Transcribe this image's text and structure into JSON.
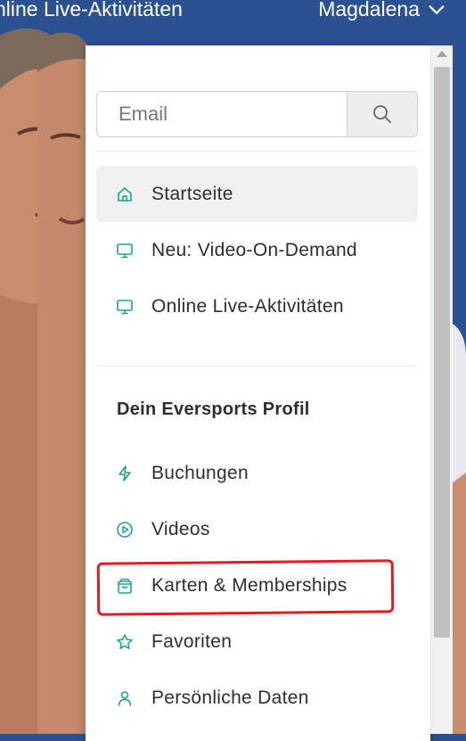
{
  "topbar": {
    "nav_text": "nline Live-Aktivitäten",
    "user_name": "Magdalena"
  },
  "search": {
    "placeholder": "Email"
  },
  "menu": {
    "main_items": [
      {
        "label": "Startseite",
        "icon": "home-icon",
        "active": true
      },
      {
        "label": "Neu: Video-On-Demand",
        "icon": "monitor-icon",
        "active": false
      },
      {
        "label": "Online Live-Aktivitäten",
        "icon": "monitor-icon",
        "active": false
      }
    ],
    "profile_title": "Dein Eversports Profil",
    "profile_items": [
      {
        "label": "Buchungen",
        "icon": "lightning-icon"
      },
      {
        "label": "Videos",
        "icon": "play-circle-icon"
      },
      {
        "label": "Karten & Memberships",
        "icon": "shopping-bag-icon"
      },
      {
        "label": "Favoriten",
        "icon": "star-icon"
      },
      {
        "label": "Persönliche Daten",
        "icon": "user-icon"
      }
    ]
  },
  "colors": {
    "icon_accent": "#1aa38a",
    "background": "#2c5192",
    "annotation": "#e01b24"
  }
}
